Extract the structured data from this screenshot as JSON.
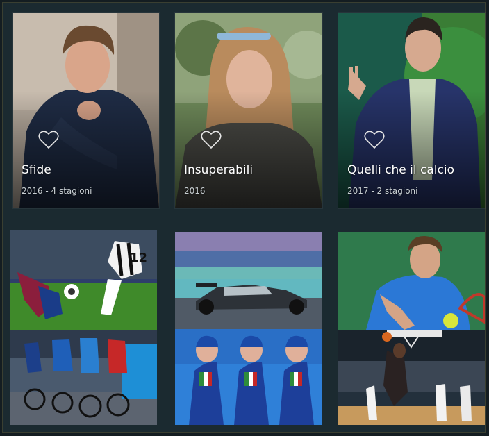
{
  "shows": [
    {
      "title": "Sfide",
      "meta": "2016 - 4 stagioni",
      "favorite_icon": "heart-outline-icon"
    },
    {
      "title": "Insuperabili",
      "meta": "2016",
      "favorite_icon": "heart-outline-icon"
    },
    {
      "title": "Quelli che il calcio",
      "meta": "2017 - 2 stagioni",
      "favorite_icon": "heart-outline-icon"
    }
  ],
  "sport_tiles": [
    {
      "subject": "football-match"
    },
    {
      "subject": "formula-1-car"
    },
    {
      "subject": "tennis-player"
    },
    {
      "subject": "cycling-race"
    },
    {
      "subject": "water-polo-team"
    },
    {
      "subject": "basketball-dunk"
    }
  ],
  "colors": {
    "page_bg": "#141d21",
    "panel_bg": "#1b2a30",
    "title_text": "#ffffff",
    "meta_text": "#c9d0d3"
  }
}
